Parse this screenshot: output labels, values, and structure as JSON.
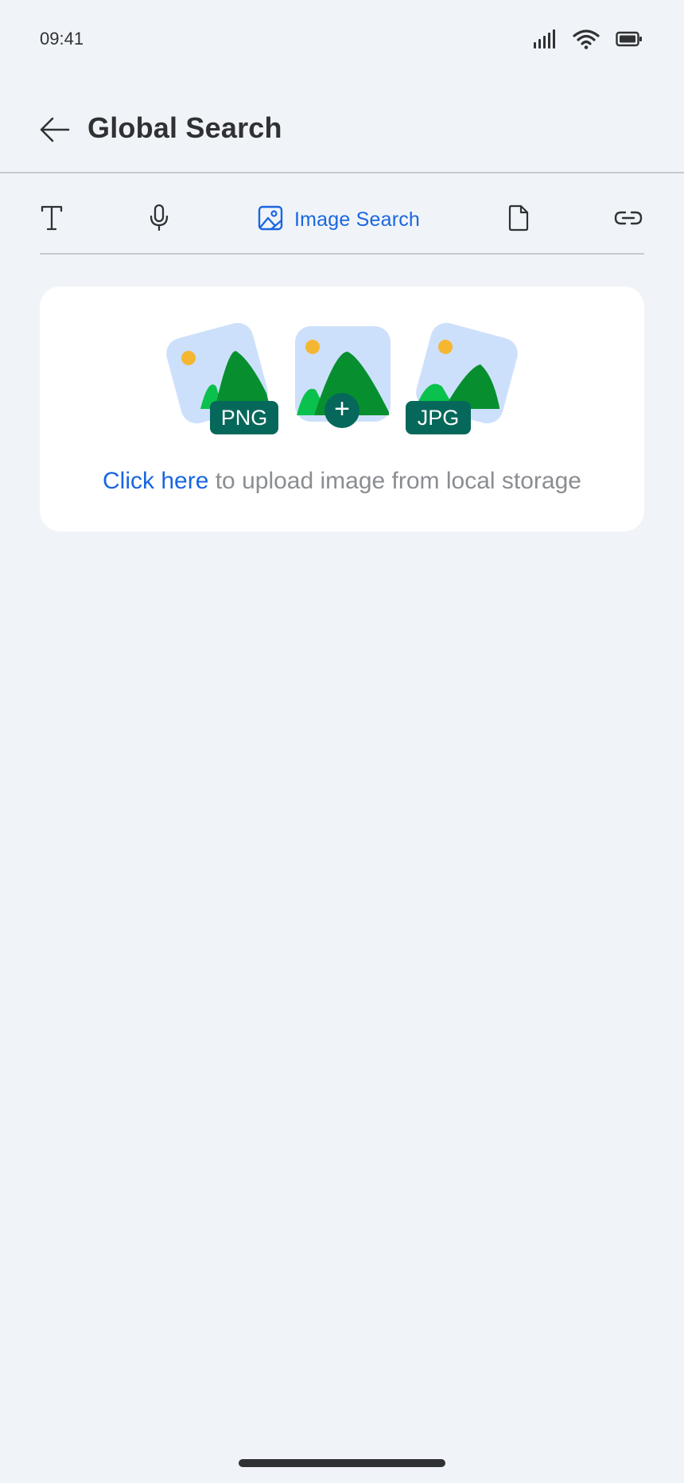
{
  "status_bar": {
    "time": "09:41",
    "icons": [
      "signal-icon",
      "wifi-icon",
      "battery-icon"
    ]
  },
  "header": {
    "back_icon": "arrow-left-icon",
    "title": "Global Search"
  },
  "tabs": [
    {
      "id": "text",
      "icon": "text-icon",
      "label": ""
    },
    {
      "id": "voice",
      "icon": "microphone-icon",
      "label": ""
    },
    {
      "id": "image",
      "icon": "image-icon",
      "label": "Image Search",
      "active": true
    },
    {
      "id": "document",
      "icon": "document-icon",
      "label": ""
    },
    {
      "id": "link",
      "icon": "link-icon",
      "label": ""
    }
  ],
  "upload": {
    "badges": {
      "png": "PNG",
      "add": "+",
      "jpg": "JPG"
    },
    "link_text": "Click here",
    "rest_text": " to upload image from local storage"
  },
  "colors": {
    "background": "#f0f4f9",
    "accent": "#1a66e0",
    "card": "#ffffff",
    "text": "#303133",
    "muted": "#8a8d91",
    "illus_bg": "#cde0fb",
    "mountain_dark": "#078f2f",
    "mountain_light": "#0bc14d",
    "sun": "#f5b731",
    "badge": "#06685a"
  }
}
